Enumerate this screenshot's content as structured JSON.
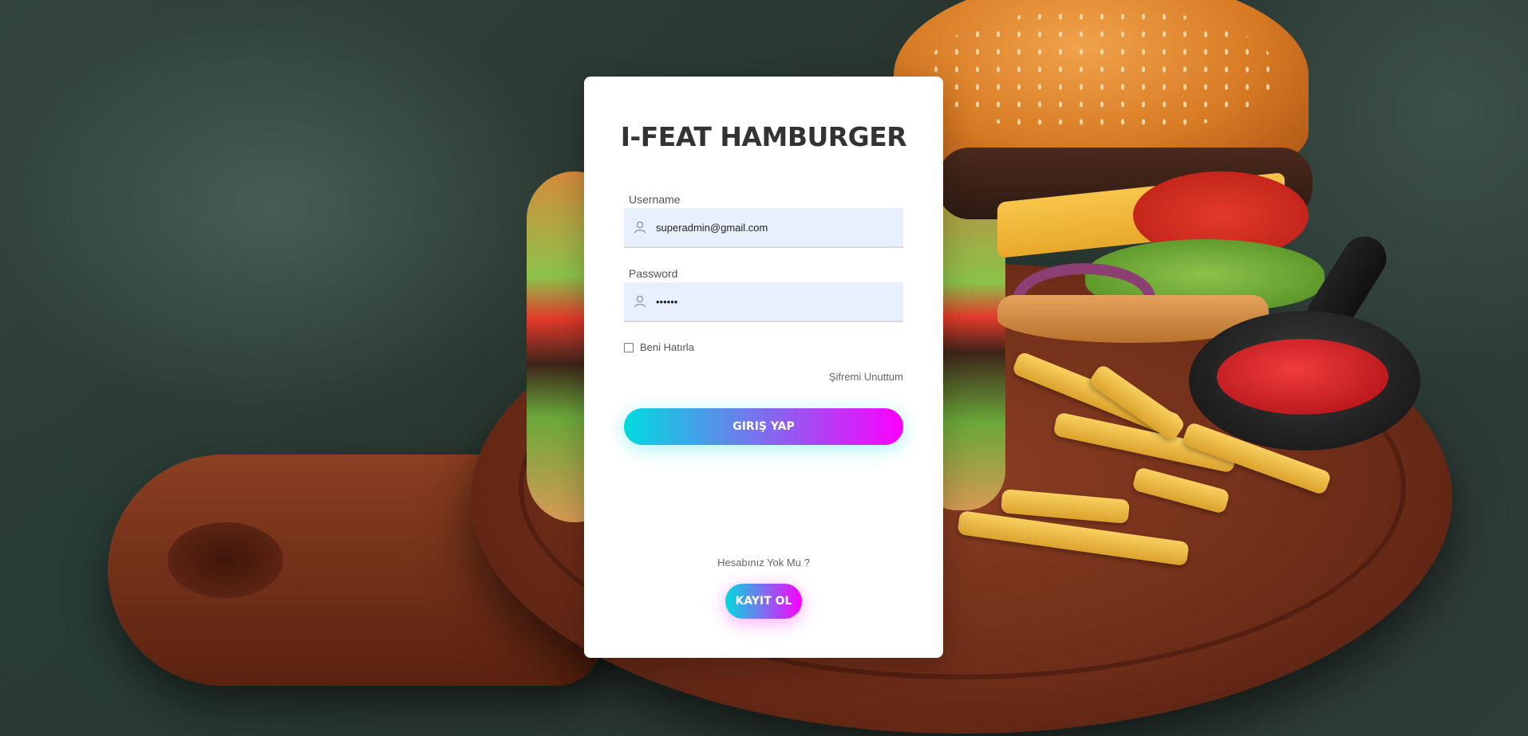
{
  "app": {
    "title": "I-FEAT HAMBURGER"
  },
  "form": {
    "username_label": "Username",
    "username_value": "superadmin@gmail.com",
    "password_label": "Password",
    "password_value": "••••••",
    "remember_label": "Beni Hatırla",
    "remember_checked": false,
    "forgot_label": "Şifremi Unuttum",
    "login_button": "GIRIŞ YAP"
  },
  "register": {
    "prompt": "Hesabınız Yok Mu ?",
    "button": "KAYIT OL"
  },
  "colors": {
    "gradient_start": "#00dbde",
    "gradient_end": "#fc00ff",
    "field_bg": "#e8f0fe"
  },
  "icons": {
    "username": "user-icon",
    "password": "user-icon"
  }
}
